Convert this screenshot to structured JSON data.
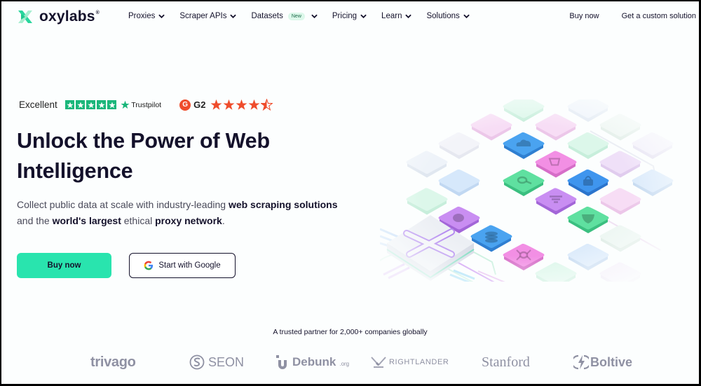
{
  "header": {
    "logo_text": "oxylabs",
    "logo_mark": "®",
    "nav": [
      {
        "label": "Proxies",
        "has_dropdown": true
      },
      {
        "label": "Scraper APIs",
        "has_dropdown": true
      },
      {
        "label": "Datasets",
        "badge": "New",
        "has_dropdown": true
      },
      {
        "label": "Pricing",
        "has_dropdown": true
      },
      {
        "label": "Learn",
        "has_dropdown": true
      },
      {
        "label": "Solutions",
        "has_dropdown": true
      }
    ],
    "buy_now": "Buy now",
    "custom_solution": "Get a custom solution"
  },
  "ratings": {
    "trustpilot_label": "Excellent",
    "trustpilot_brand": "Trustpilot",
    "trustpilot_stars": 5,
    "g2_brand": "G2",
    "g2_stars": 4.5
  },
  "hero": {
    "title_line1": "Unlock the Power of Web",
    "title_line2": "Intelligence",
    "subtitle": {
      "p1": "Collect public data at scale with industry-leading ",
      "b1": "web scraping solutions",
      "p2": " and the ",
      "b2": "world's largest",
      "p3": " ethical ",
      "b3": "proxy network",
      "p4": "."
    },
    "buy_button": "Buy now",
    "google_button": "Start with Google"
  },
  "trusted": {
    "heading": "A trusted partner for 2,000+ companies globally",
    "logos": [
      "trivago",
      "SEON",
      "Debunk",
      ".org",
      "RIGHTLANDER",
      "Stanford",
      "Boltive"
    ]
  },
  "colors": {
    "accent": "#29e4ae",
    "text": "#14112b",
    "trustpilot": "#1ab67a",
    "g2": "#ef4c2b",
    "logo_gray": "#8f91a3"
  },
  "illustration": {
    "tile_icons": [
      "cloud",
      "search",
      "cart",
      "location-pin",
      "list",
      "lock",
      "database",
      "shield",
      "spider"
    ]
  }
}
